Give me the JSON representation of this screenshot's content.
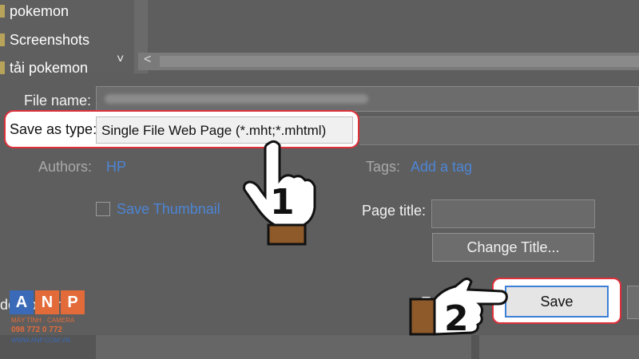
{
  "tree": {
    "items": [
      "pokemon",
      "Screenshots",
      "tải pokemon"
    ],
    "collapse_glyph": "˅"
  },
  "hscroll": {
    "left_glyph": "<"
  },
  "form": {
    "file_name_label": "File name:",
    "save_as_type_label": "Save as type:",
    "save_as_type_value": "Single File Web Page (*.mht;*.mhtml)",
    "authors_label": "Authors:",
    "authors_value": "HP",
    "tags_label": "Tags:",
    "tags_value": "Add a tag",
    "save_thumbnail_label": "Save Thumbnail",
    "page_title_label": "Page title:",
    "change_title_label": "Change Title...",
    "hide_folders_label": "de Folders",
    "tools_partial": "To",
    "save_label": "Save"
  },
  "steps": {
    "step1": "1",
    "step2": "2"
  },
  "logo": {
    "letters": [
      "A",
      "N",
      "P"
    ],
    "line1": "MÁY TÍNH · CAMERA",
    "phone": "098 772 0 772",
    "site": "WWW.ANP.COM.VN"
  },
  "colors": {
    "highlight": "#e0303a",
    "link": "#4d85d4",
    "focus": "#3c7fd6"
  }
}
